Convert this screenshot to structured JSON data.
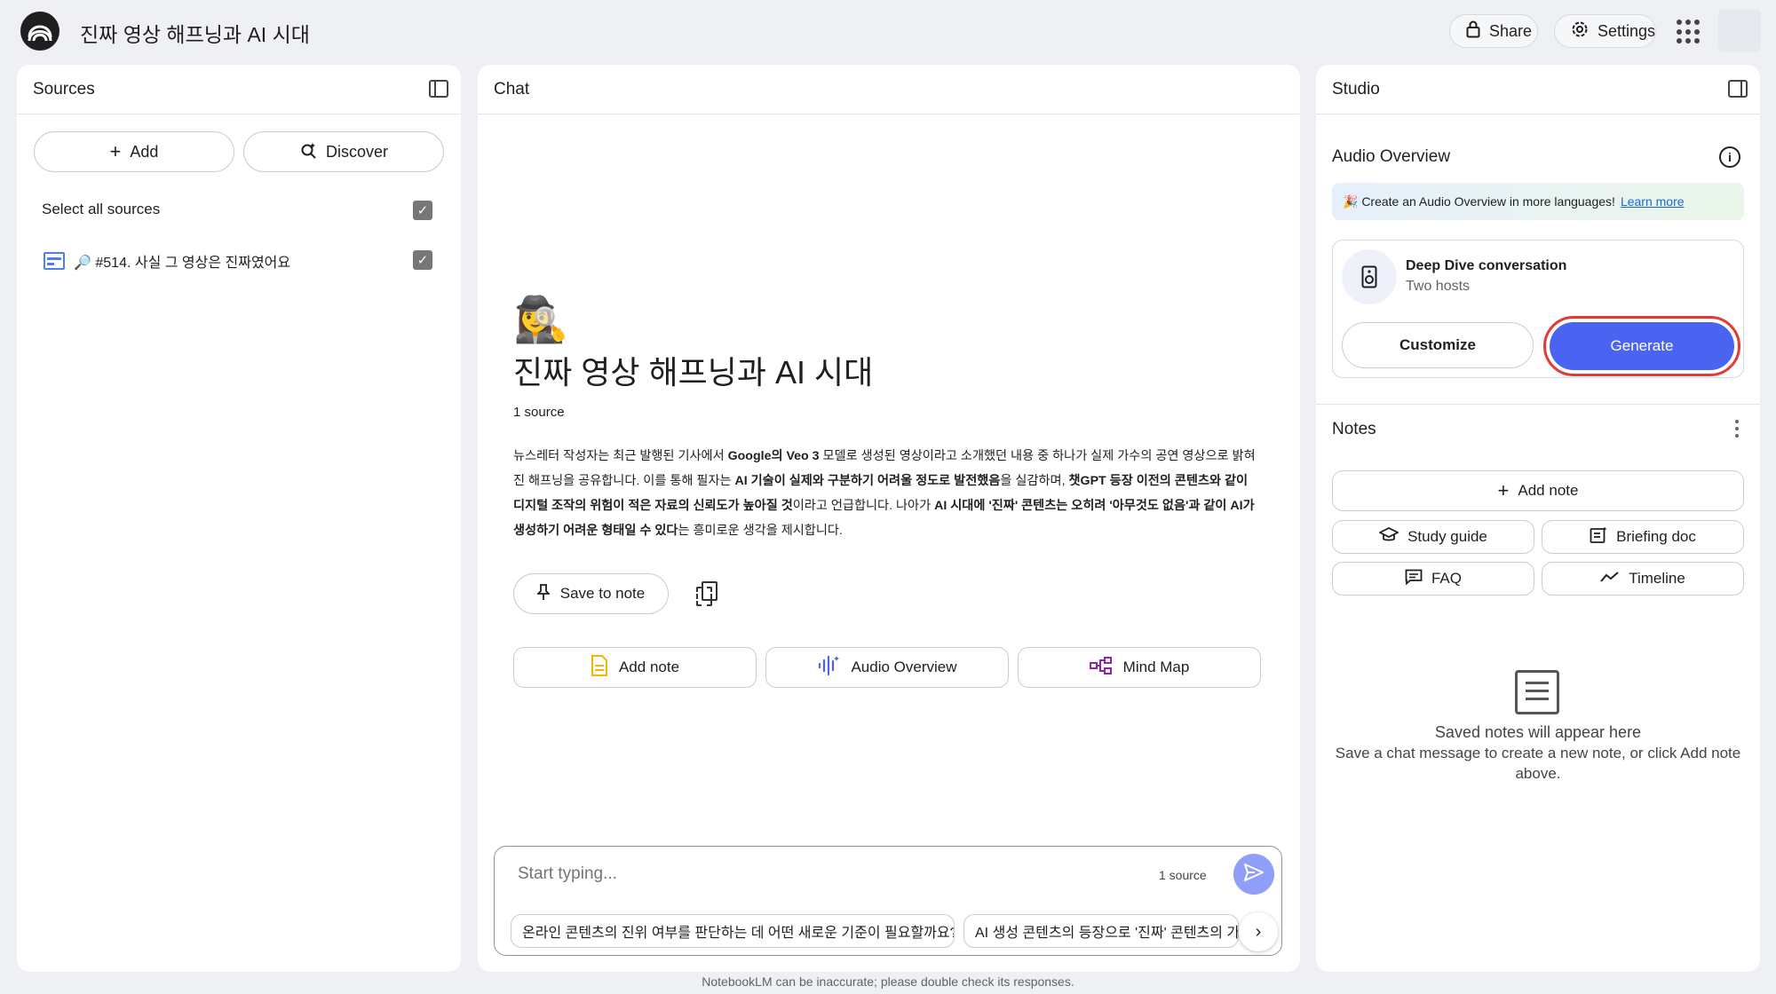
{
  "header": {
    "title": "진짜 영상 해프닝과 AI 시대",
    "share_label": "Share",
    "settings_label": "Settings"
  },
  "sources": {
    "panel_title": "Sources",
    "add_label": "Add",
    "discover_label": "Discover",
    "select_all_label": "Select all sources",
    "items": [
      {
        "label": "🔎 #514. 사실 그 영상은 진짜였어요",
        "checked": true
      }
    ]
  },
  "chat": {
    "panel_title": "Chat",
    "emoji": "🕵️‍♀️",
    "title": "진짜 영상 해프닝과 AI 시대",
    "source_count": "1 source",
    "summary": [
      {
        "t": "뉴스레터 작성자는 최근 발행된 기사에서 ",
        "b": false
      },
      {
        "t": "Google의 Veo 3",
        "b": true
      },
      {
        "t": " 모델로 생성된 영상이라고 소개했던 내용 중 하나가 실제 가수의 공연 영상으로 밝혀진 해프닝을 공유합니다. 이를 통해 필자는 ",
        "b": false
      },
      {
        "t": "AI 기술이 실제와 구분하기 어려울 정도로 발전했음",
        "b": true
      },
      {
        "t": "을 실감하며, ",
        "b": false
      },
      {
        "t": "챗GPT 등장 이전의 콘텐츠와 같이 디지털 조작의 위험이 적은 자료의 신뢰도가 높아질 것",
        "b": true
      },
      {
        "t": "이라고 언급합니다. 나아가 ",
        "b": false
      },
      {
        "t": "AI 시대에 '진짜' 콘텐츠는 오히려 '아무것도 없음'과 같이 AI가 생성하기 어려운 형태일 수 있다",
        "b": true
      },
      {
        "t": "는 흥미로운 생각을 제시합니다.",
        "b": false
      }
    ],
    "save_to_note_label": "Save to note",
    "actions": {
      "add_note": "Add note",
      "audio_overview": "Audio Overview",
      "mind_map": "Mind Map"
    },
    "composer": {
      "placeholder": "Start typing...",
      "source_count": "1 source"
    },
    "suggestions": [
      "온라인 콘텐츠의 진위 여부를 판단하는 데 어떤 새로운 기준이 필요할까요?",
      "AI 생성 콘텐츠의 등장으로 '진짜' 콘텐츠의 가치"
    ]
  },
  "studio": {
    "panel_title": "Studio",
    "audio_overview_title": "Audio Overview",
    "banner_text": "🎉 Create an Audio Overview in more languages!",
    "banner_link": "Learn more",
    "card_title": "Deep Dive conversation",
    "card_subtitle": "Two hosts",
    "customize_label": "Customize",
    "generate_label": "Generate",
    "notes_title": "Notes",
    "add_note_label": "Add note",
    "study_guide_label": "Study guide",
    "briefing_doc_label": "Briefing doc",
    "faq_label": "FAQ",
    "timeline_label": "Timeline",
    "empty_title": "Saved notes will appear here",
    "empty_subtitle": "Save a chat message to create a new note, or click Add note above."
  },
  "footer": {
    "disclaimer": "NotebookLM can be inaccurate; please double check its responses."
  },
  "colors": {
    "accent": "#4a63f0",
    "highlight_box": "#e53935",
    "link": "#1a66d6"
  }
}
